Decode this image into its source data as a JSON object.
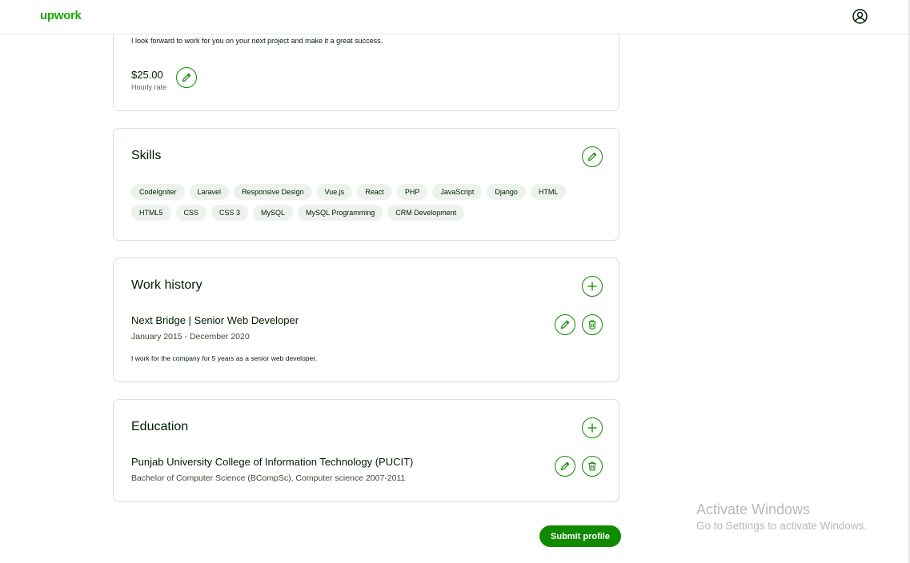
{
  "header": {
    "logo": "upwork",
    "user_icon": "user-circle-icon"
  },
  "intro": {
    "text": "I look forward to work for you on your next project and make it a great success.",
    "rate_value": "$25.00",
    "rate_label": "Hourly rate"
  },
  "skills": {
    "title": "Skills",
    "items": [
      "CodeIgniter",
      "Laravel",
      "Responsive Design",
      "Vue.js",
      "React",
      "PHP",
      "JavaScript",
      "Django",
      "HTML",
      "HTML5",
      "CSS",
      "CSS 3",
      "MySQL",
      "MySQL Programming",
      "CRM Development"
    ]
  },
  "work_history": {
    "title": "Work history",
    "entries": [
      {
        "title": "Next Bridge | Senior Web Developer",
        "dates": "January 2015 - December 2020",
        "description": "I work for the company for 5 years as a senior web developer."
      }
    ]
  },
  "education": {
    "title": "Education",
    "entries": [
      {
        "school": "Punjab University College of Information Technology (PUCIT)",
        "degree": "Bachelor of Computer Science (BCompSc), Computer science 2007-2011"
      }
    ]
  },
  "submit_label": "Submit profile",
  "watermark": {
    "title": "Activate Windows",
    "subtitle": "Go to Settings to activate Windows."
  },
  "colors": {
    "brand": "#14a800",
    "button": "#108a00",
    "chip_bg": "#eef2ee",
    "border": "#d5e0d5"
  }
}
